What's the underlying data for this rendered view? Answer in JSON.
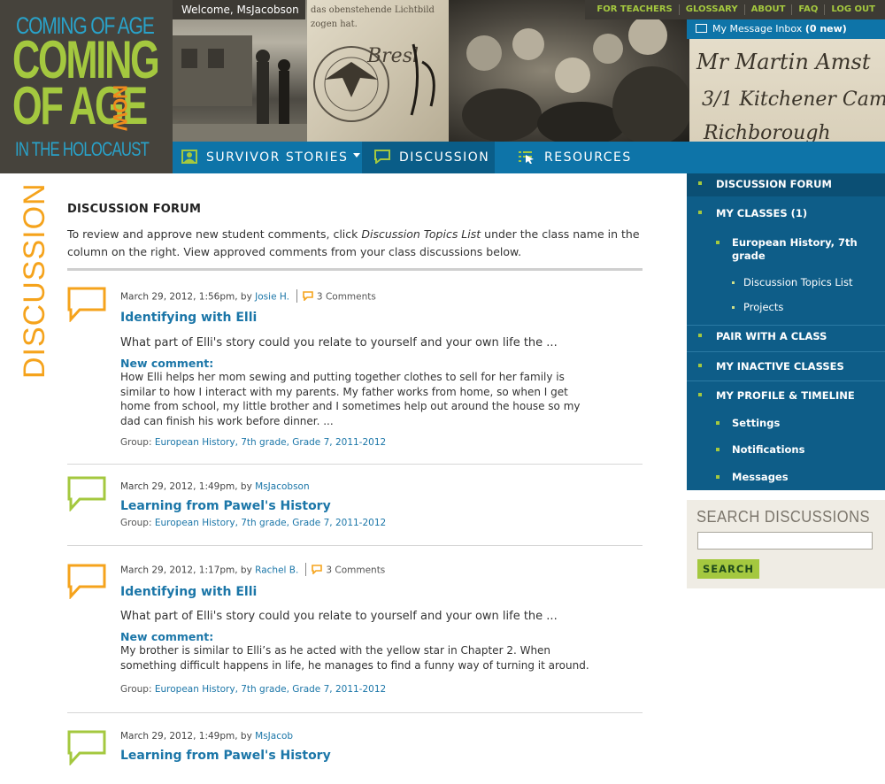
{
  "logo": {
    "line1": "COMING OF AGE",
    "line2": "COMING",
    "line3": "OF AGE",
    "now": "NOW",
    "line4": "IN THE HOLOCAUST"
  },
  "welcome": "Welcome, MsJacobson",
  "topnav": [
    "FOR TEACHERS",
    "GLOSSARY",
    "ABOUT",
    "FAQ",
    "LOG OUT"
  ],
  "inbox": {
    "label": "My Message Inbox",
    "count": "(0 new)"
  },
  "mainnav": {
    "survivor": "SURVIVOR STORIES",
    "discussion": "DISCUSSION",
    "resources": "RESOURCES"
  },
  "section_word": "DISCUSSION",
  "page": {
    "title": "DISCUSSION FORUM",
    "intro_a": "To review and approve new student comments, click ",
    "intro_link": "Discussion Topics List",
    "intro_b": " under the class name in the column on the right. View approved comments from your class discussions below."
  },
  "posts": [
    {
      "date": "March 29, 2012, 1:56pm, by",
      "author": "Josie H.",
      "comments": "3 Comments",
      "title": "Identifying with Elli",
      "excerpt": "What part of Elli's story could you relate to yourself and your own life the ...",
      "new_comment_label": "New comment:",
      "new_comment": "How Elli helps her mom sewing and putting together clothes to sell for her family is similar to how I interact with my parents. My father works from home, so when I get home from school, my little brother and I sometimes help out around the house so my dad can finish his work before dinner. ...",
      "group_label": "Group:",
      "group": "European History, 7th grade, Grade 7, 2011-2012"
    },
    {
      "date": "March 29, 2012, 1:49pm, by",
      "author": "MsJacobson",
      "title": "Learning from Pawel's History",
      "group_label": "Group:",
      "group": "European History, 7th grade, Grade 7, 2011-2012"
    },
    {
      "date": "March 29, 2012, 1:17pm, by",
      "author": "Rachel B.",
      "comments": "3 Comments",
      "title": "Identifying with Elli",
      "excerpt": "What part of Elli's story could you relate to yourself and your own life the ...",
      "new_comment_label": "New comment:",
      "new_comment": "My brother is similar to Elli’s as he acted with the yellow star in Chapter 2. When something difficult happens in life, he manages to find a funny way of turning it around.",
      "group_label": "Group:",
      "group": "European History, 7th grade, Grade 7, 2011-2012"
    },
    {
      "date": "March 29, 2012, 1:49pm, by",
      "author": "MsJacob",
      "title": "Learning from Pawel's History"
    }
  ],
  "sidebar": {
    "forum": "DISCUSSION FORUM",
    "my_classes": "MY CLASSES (1)",
    "class_name": "European History, 7th grade",
    "topics_list": "Discussion Topics List",
    "projects": "Projects",
    "pair": "PAIR WITH A CLASS",
    "inactive": "MY INACTIVE CLASSES",
    "profile": "MY PROFILE & TIMELINE",
    "settings": "Settings",
    "notifications": "Notifications",
    "messages": "Messages"
  },
  "search": {
    "title": "SEARCH DISCUSSIONS",
    "value": "",
    "button": "SEARCH"
  },
  "colors": {
    "accent_blue": "#0e74a8",
    "sidebar_blue": "#0e5d88",
    "green": "#a4c83f",
    "orange": "#f5a31c",
    "link": "#1b76a8"
  },
  "icons": {
    "orange_bubble": "speech-bubble-orange",
    "green_bubble": "speech-bubble-green",
    "comment": "comment-icon",
    "envelope": "envelope-icon"
  }
}
